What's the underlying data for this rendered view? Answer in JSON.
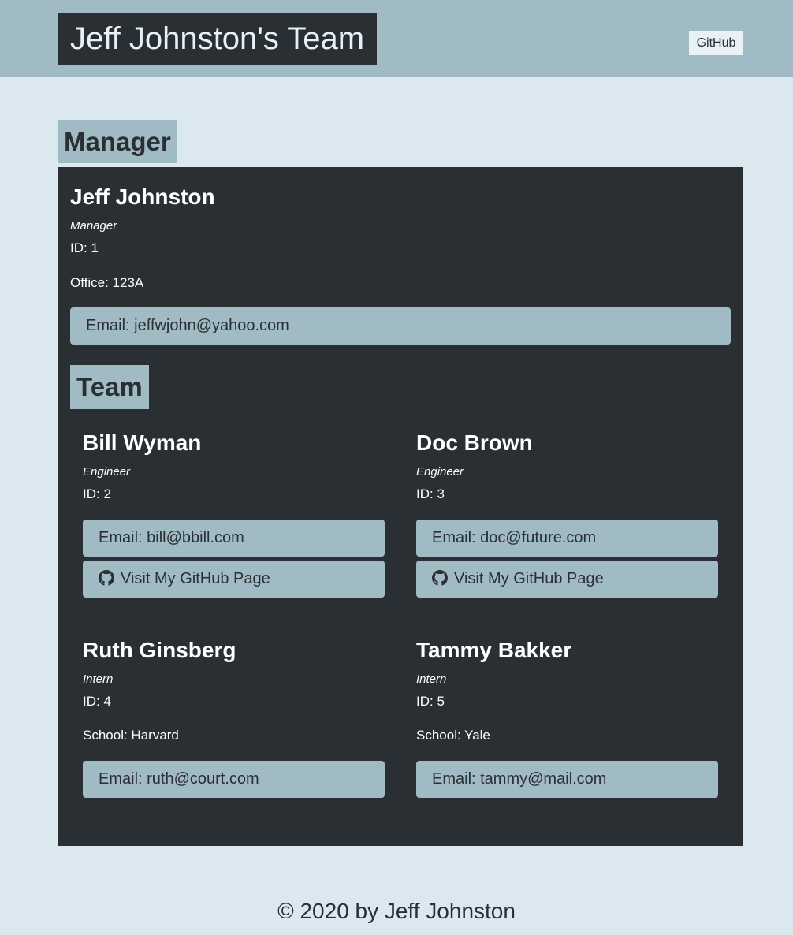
{
  "header": {
    "title": "Jeff Johnston's Team",
    "github_label": "GitHub"
  },
  "manager_section": {
    "title": "Manager",
    "name": "Jeff Johnston",
    "role": "Manager",
    "id": "ID: 1",
    "office": "Office: 123A",
    "email": "Email: jeffwjohn@yahoo.com"
  },
  "team_section": {
    "title": "Team",
    "members": [
      {
        "name": "Bill Wyman",
        "role": "Engineer",
        "id": "ID: 2",
        "email": "Email: bill@bbill.com",
        "github": "Visit My GitHub Page"
      },
      {
        "name": "Doc Brown",
        "role": "Engineer",
        "id": "ID: 3",
        "email": "Email: doc@future.com",
        "github": "Visit My GitHub Page"
      },
      {
        "name": "Ruth Ginsberg",
        "role": "Intern",
        "id": "ID: 4",
        "school": "School: Harvard",
        "email": "Email: ruth@court.com"
      },
      {
        "name": "Tammy Bakker",
        "role": "Intern",
        "id": "ID: 5",
        "school": "School: Yale",
        "email": "Email: tammy@mail.com"
      }
    ]
  },
  "footer": {
    "text": "© 2020 by Jeff Johnston"
  },
  "colors": {
    "page_bg": "#dce8ef",
    "accent": "#a1bbc5",
    "panel_bg": "#2a2f34"
  },
  "icons": {
    "github_link_icon": "github-icon"
  }
}
